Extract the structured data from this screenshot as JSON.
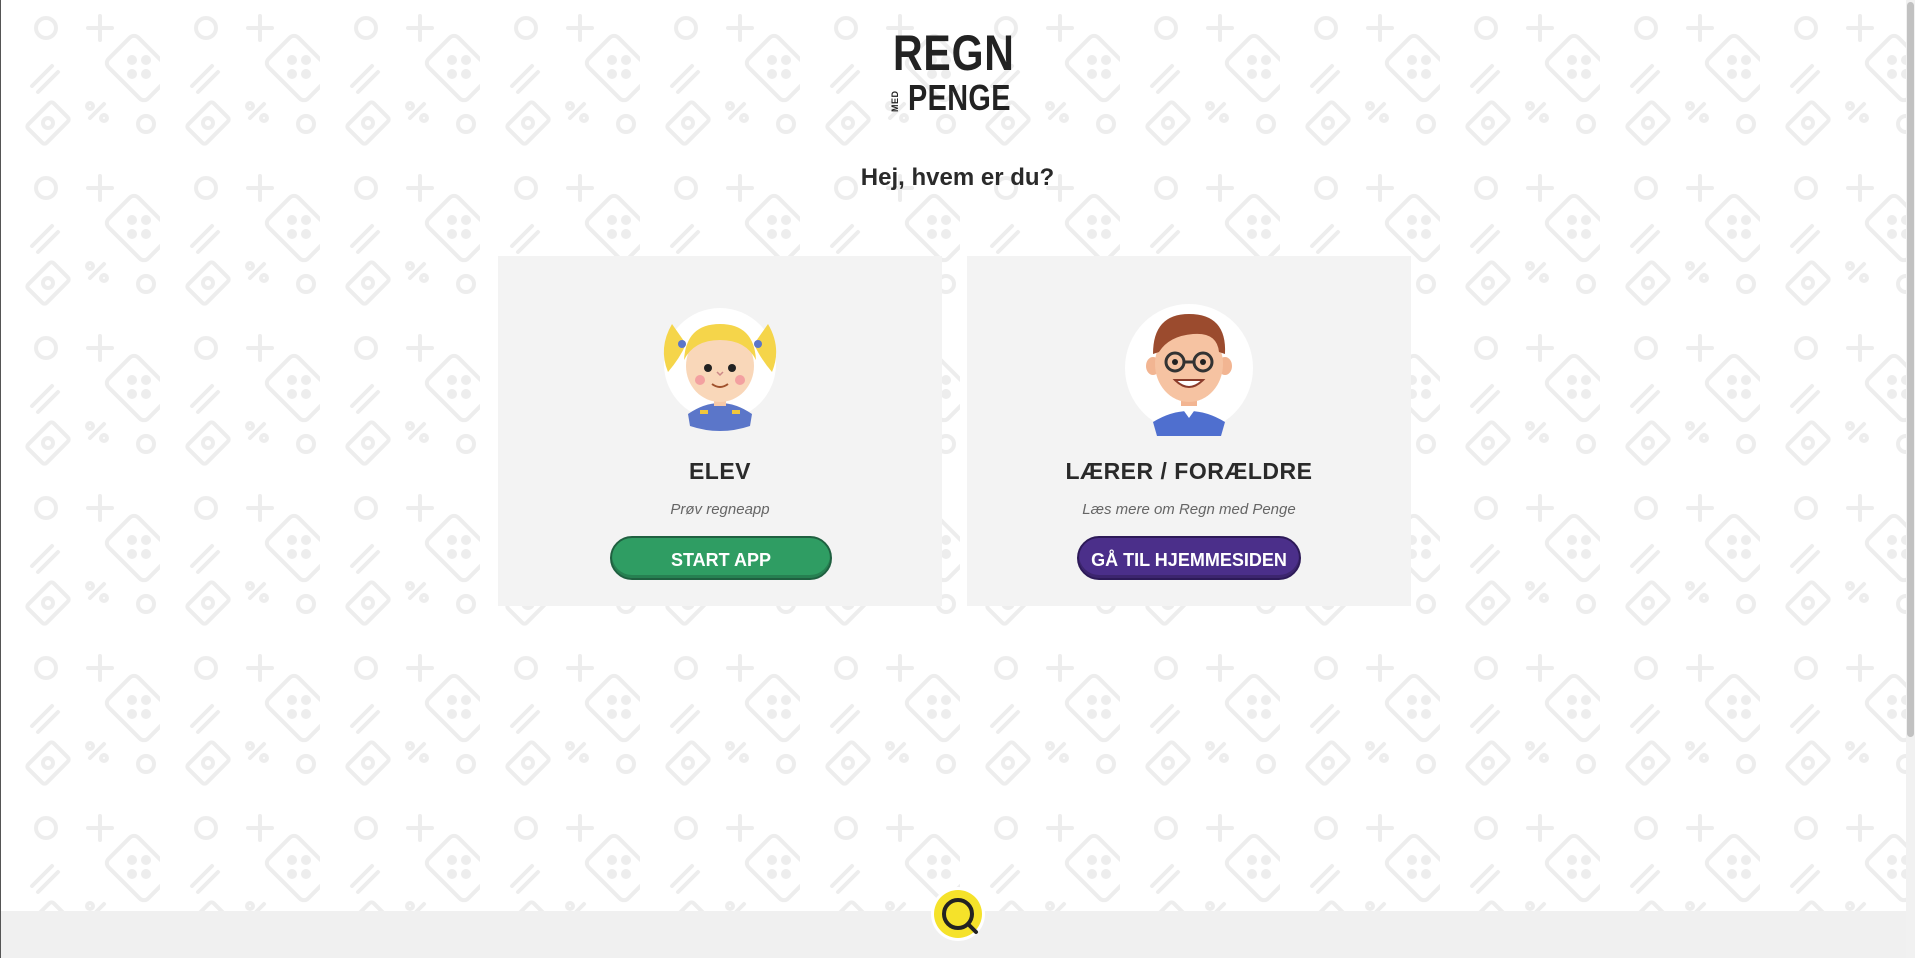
{
  "logo": {
    "line1": "REGN",
    "small": "MED",
    "line2": "PENGE"
  },
  "heading": "Hej, hvem er du?",
  "cards": [
    {
      "title": "ELEV",
      "subtitle": "Prøv regneapp",
      "button": "START APP",
      "button_color": "#2f9d63",
      "avatar": "girl-avatar-icon"
    },
    {
      "title": "LÆRER / FORÆLDRE",
      "subtitle": "Læs mere om Regn med Penge",
      "button": "GÅ TIL HJEMMESIDEN",
      "button_color": "#4b2f8a",
      "avatar": "teacher-avatar-icon"
    }
  ],
  "footer": {
    "icon": "coin-logo-icon",
    "accent": "#f5e22a"
  }
}
